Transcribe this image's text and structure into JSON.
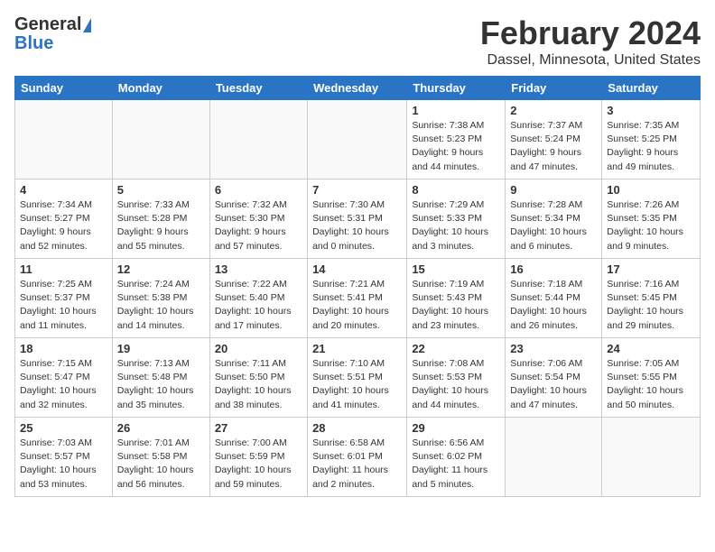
{
  "header": {
    "logo_general": "General",
    "logo_blue": "Blue",
    "month": "February 2024",
    "location": "Dassel, Minnesota, United States"
  },
  "weekdays": [
    "Sunday",
    "Monday",
    "Tuesday",
    "Wednesday",
    "Thursday",
    "Friday",
    "Saturday"
  ],
  "weeks": [
    [
      {
        "day": "",
        "info": ""
      },
      {
        "day": "",
        "info": ""
      },
      {
        "day": "",
        "info": ""
      },
      {
        "day": "",
        "info": ""
      },
      {
        "day": "1",
        "info": "Sunrise: 7:38 AM\nSunset: 5:23 PM\nDaylight: 9 hours\nand 44 minutes."
      },
      {
        "day": "2",
        "info": "Sunrise: 7:37 AM\nSunset: 5:24 PM\nDaylight: 9 hours\nand 47 minutes."
      },
      {
        "day": "3",
        "info": "Sunrise: 7:35 AM\nSunset: 5:25 PM\nDaylight: 9 hours\nand 49 minutes."
      }
    ],
    [
      {
        "day": "4",
        "info": "Sunrise: 7:34 AM\nSunset: 5:27 PM\nDaylight: 9 hours\nand 52 minutes."
      },
      {
        "day": "5",
        "info": "Sunrise: 7:33 AM\nSunset: 5:28 PM\nDaylight: 9 hours\nand 55 minutes."
      },
      {
        "day": "6",
        "info": "Sunrise: 7:32 AM\nSunset: 5:30 PM\nDaylight: 9 hours\nand 57 minutes."
      },
      {
        "day": "7",
        "info": "Sunrise: 7:30 AM\nSunset: 5:31 PM\nDaylight: 10 hours\nand 0 minutes."
      },
      {
        "day": "8",
        "info": "Sunrise: 7:29 AM\nSunset: 5:33 PM\nDaylight: 10 hours\nand 3 minutes."
      },
      {
        "day": "9",
        "info": "Sunrise: 7:28 AM\nSunset: 5:34 PM\nDaylight: 10 hours\nand 6 minutes."
      },
      {
        "day": "10",
        "info": "Sunrise: 7:26 AM\nSunset: 5:35 PM\nDaylight: 10 hours\nand 9 minutes."
      }
    ],
    [
      {
        "day": "11",
        "info": "Sunrise: 7:25 AM\nSunset: 5:37 PM\nDaylight: 10 hours\nand 11 minutes."
      },
      {
        "day": "12",
        "info": "Sunrise: 7:24 AM\nSunset: 5:38 PM\nDaylight: 10 hours\nand 14 minutes."
      },
      {
        "day": "13",
        "info": "Sunrise: 7:22 AM\nSunset: 5:40 PM\nDaylight: 10 hours\nand 17 minutes."
      },
      {
        "day": "14",
        "info": "Sunrise: 7:21 AM\nSunset: 5:41 PM\nDaylight: 10 hours\nand 20 minutes."
      },
      {
        "day": "15",
        "info": "Sunrise: 7:19 AM\nSunset: 5:43 PM\nDaylight: 10 hours\nand 23 minutes."
      },
      {
        "day": "16",
        "info": "Sunrise: 7:18 AM\nSunset: 5:44 PM\nDaylight: 10 hours\nand 26 minutes."
      },
      {
        "day": "17",
        "info": "Sunrise: 7:16 AM\nSunset: 5:45 PM\nDaylight: 10 hours\nand 29 minutes."
      }
    ],
    [
      {
        "day": "18",
        "info": "Sunrise: 7:15 AM\nSunset: 5:47 PM\nDaylight: 10 hours\nand 32 minutes."
      },
      {
        "day": "19",
        "info": "Sunrise: 7:13 AM\nSunset: 5:48 PM\nDaylight: 10 hours\nand 35 minutes."
      },
      {
        "day": "20",
        "info": "Sunrise: 7:11 AM\nSunset: 5:50 PM\nDaylight: 10 hours\nand 38 minutes."
      },
      {
        "day": "21",
        "info": "Sunrise: 7:10 AM\nSunset: 5:51 PM\nDaylight: 10 hours\nand 41 minutes."
      },
      {
        "day": "22",
        "info": "Sunrise: 7:08 AM\nSunset: 5:53 PM\nDaylight: 10 hours\nand 44 minutes."
      },
      {
        "day": "23",
        "info": "Sunrise: 7:06 AM\nSunset: 5:54 PM\nDaylight: 10 hours\nand 47 minutes."
      },
      {
        "day": "24",
        "info": "Sunrise: 7:05 AM\nSunset: 5:55 PM\nDaylight: 10 hours\nand 50 minutes."
      }
    ],
    [
      {
        "day": "25",
        "info": "Sunrise: 7:03 AM\nSunset: 5:57 PM\nDaylight: 10 hours\nand 53 minutes."
      },
      {
        "day": "26",
        "info": "Sunrise: 7:01 AM\nSunset: 5:58 PM\nDaylight: 10 hours\nand 56 minutes."
      },
      {
        "day": "27",
        "info": "Sunrise: 7:00 AM\nSunset: 5:59 PM\nDaylight: 10 hours\nand 59 minutes."
      },
      {
        "day": "28",
        "info": "Sunrise: 6:58 AM\nSunset: 6:01 PM\nDaylight: 11 hours\nand 2 minutes."
      },
      {
        "day": "29",
        "info": "Sunrise: 6:56 AM\nSunset: 6:02 PM\nDaylight: 11 hours\nand 5 minutes."
      },
      {
        "day": "",
        "info": ""
      },
      {
        "day": "",
        "info": ""
      }
    ]
  ]
}
